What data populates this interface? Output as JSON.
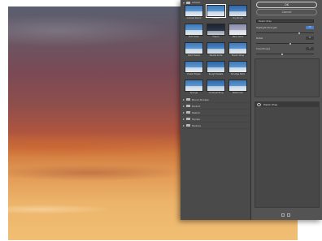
{
  "filter_gallery": {
    "confirm_label": "OK",
    "cancel_label": "Cancel",
    "group_label": "Artistic",
    "thumbnails": [
      {
        "caption": "Colored Pencil",
        "style": "blue",
        "selected": false
      },
      {
        "caption": "Cutout",
        "style": "blue",
        "selected": true
      },
      {
        "caption": "Dry Brush",
        "style": "blue2",
        "selected": false
      },
      {
        "caption": "Film Grain",
        "style": "blue",
        "selected": false
      },
      {
        "caption": "Fresco",
        "style": "dark",
        "selected": false
      },
      {
        "caption": "Neon Glow",
        "style": "pale",
        "selected": false
      },
      {
        "caption": "Paint Daubs",
        "style": "blue",
        "selected": false
      },
      {
        "caption": "Palette Knife",
        "style": "blue2",
        "selected": false
      },
      {
        "caption": "Plastic Wrap",
        "style": "blue",
        "selected": false
      },
      {
        "caption": "Poster Edges",
        "style": "blue",
        "selected": false
      },
      {
        "caption": "Rough Pastels",
        "style": "blue2",
        "selected": false
      },
      {
        "caption": "Smudge Stick",
        "style": "blue",
        "selected": false
      },
      {
        "caption": "Sponge",
        "style": "blue",
        "selected": false
      },
      {
        "caption": "Underpainting",
        "style": "blue2",
        "selected": false
      },
      {
        "caption": "Watercolor",
        "style": "blue",
        "selected": false
      }
    ],
    "categories": [
      "Brush Strokes",
      "Distort",
      "Sketch",
      "Stylize",
      "Texture"
    ],
    "effect_dropdown": "Plastic Wrap",
    "params": [
      {
        "label": "Highlight Strength",
        "value": "15",
        "active": true,
        "fraction": 0.75
      },
      {
        "label": "Detail",
        "value": "9",
        "active": false,
        "fraction": 0.6
      },
      {
        "label": "Smoothness",
        "value": "7",
        "active": false,
        "fraction": 0.45
      }
    ],
    "layer_name": "Plastic Wrap"
  }
}
